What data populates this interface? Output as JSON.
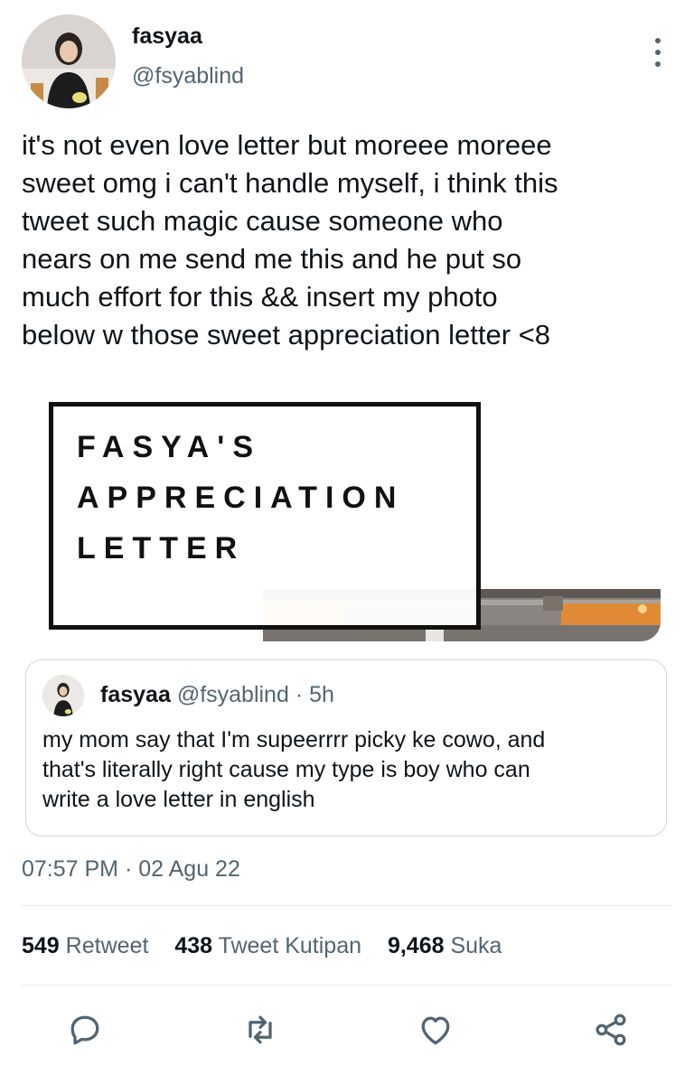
{
  "author": {
    "display_name": "fasyaa",
    "handle": "@fsyablind"
  },
  "tweet": {
    "text": "it's not even love letter but moreee moreee\nsweet omg i can't handle myself, i think this\ntweet such magic cause someone who\nnears on me send me this and he put so\nmuch effort for this && insert my photo\nbelow w those sweet appreciation letter <8"
  },
  "media": {
    "letter_lines": [
      "FASYA'S",
      "APPRECIATION",
      "LETTER"
    ]
  },
  "quoted_tweet": {
    "display_name": "fasyaa",
    "handle": "@fsyablind",
    "separator": "·",
    "time": "5h",
    "text": "my mom say that I'm supeerrrr picky ke cowo, and\nthat's literally right cause my type is boy who can\nwrite a love letter in english"
  },
  "meta": {
    "time": "07:57 PM",
    "separator": "·",
    "date": "02 Agu 22"
  },
  "stats": [
    {
      "count": "549",
      "label": "Retweet"
    },
    {
      "count": "438",
      "label": "Tweet Kutipan"
    },
    {
      "count": "9,468",
      "label": "Suka"
    }
  ],
  "actions": [
    {
      "icon": "reply-icon"
    },
    {
      "icon": "retweet-icon"
    },
    {
      "icon": "like-icon"
    },
    {
      "icon": "share-icon"
    }
  ],
  "colors": {
    "text": "#0f1419",
    "secondary": "#536471",
    "border": "#cfd9de",
    "divider": "#e4e8eb"
  }
}
